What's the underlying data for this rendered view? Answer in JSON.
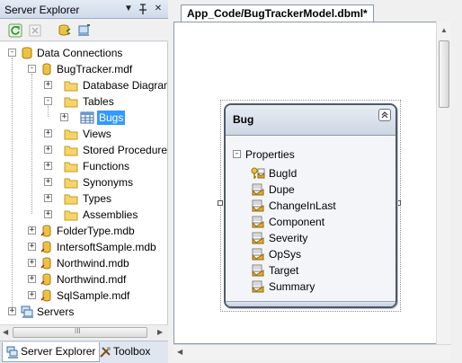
{
  "server_explorer": {
    "title": "Server Explorer",
    "title_buttons": {
      "dropdown": "▼",
      "pin": "⊥",
      "close": "✕"
    },
    "toolbar": [
      "refresh-icon",
      "stop-icon",
      "connect-database-icon",
      "connect-server-icon"
    ],
    "tree": [
      {
        "label": "Data Connections",
        "icon": "data-connections-icon",
        "expander": "-"
      },
      {
        "label": "BugTracker.mdf",
        "icon": "database-icon",
        "expander": "-"
      },
      {
        "label": "Database Diagrams",
        "icon": "folder-icon",
        "expander": "+"
      },
      {
        "label": "Tables",
        "icon": "folder-icon",
        "expander": "-"
      },
      {
        "label": "Bugs",
        "icon": "table-icon",
        "expander": "+",
        "selected": true
      },
      {
        "label": "Views",
        "icon": "folder-icon",
        "expander": "+"
      },
      {
        "label": "Stored Procedures",
        "icon": "folder-icon",
        "expander": "+"
      },
      {
        "label": "Functions",
        "icon": "folder-icon",
        "expander": "+"
      },
      {
        "label": "Synonyms",
        "icon": "folder-icon",
        "expander": "+"
      },
      {
        "label": "Types",
        "icon": "folder-icon",
        "expander": "+"
      },
      {
        "label": "Assemblies",
        "icon": "folder-icon",
        "expander": "+"
      },
      {
        "label": "FolderType.mdb",
        "icon": "database-icon",
        "expander": "+"
      },
      {
        "label": "IntersoftSample.mdb",
        "icon": "database-icon",
        "expander": "+"
      },
      {
        "label": "Northwind.mdb",
        "icon": "database-icon",
        "expander": "+"
      },
      {
        "label": "Northwind.mdf",
        "icon": "database-icon",
        "expander": "+"
      },
      {
        "label": "SqlSample.mdf",
        "icon": "database-icon",
        "expander": "+"
      },
      {
        "label": "Servers",
        "icon": "servers-icon",
        "expander": "+"
      }
    ],
    "scroll_thumb_label": "III",
    "bottom_tabs": [
      {
        "label": "Server Explorer",
        "icon": "server-explorer-icon",
        "active": true
      },
      {
        "label": "Toolbox",
        "icon": "toolbox-icon",
        "active": false
      }
    ]
  },
  "document": {
    "tab_title": "App_Code/BugTrackerModel.dbml*",
    "entity": {
      "name": "Bug",
      "collapse_glyph": "⌃",
      "section_label": "Properties",
      "section_expander": "-",
      "properties": [
        {
          "name": "BugId",
          "icon": "key-property-icon"
        },
        {
          "name": "Dupe",
          "icon": "property-icon"
        },
        {
          "name": "ChangeInLast",
          "icon": "property-icon"
        },
        {
          "name": "Component",
          "icon": "property-icon"
        },
        {
          "name": "Severity",
          "icon": "property-icon"
        },
        {
          "name": "OpSys",
          "icon": "property-icon"
        },
        {
          "name": "Target",
          "icon": "property-icon"
        },
        {
          "name": "Summary",
          "icon": "property-icon"
        }
      ]
    }
  },
  "colors": {
    "selection": "#3399ff",
    "folder": "#f2c74a",
    "titlebar": "#cfdaea",
    "entity_border": "#50596a"
  }
}
